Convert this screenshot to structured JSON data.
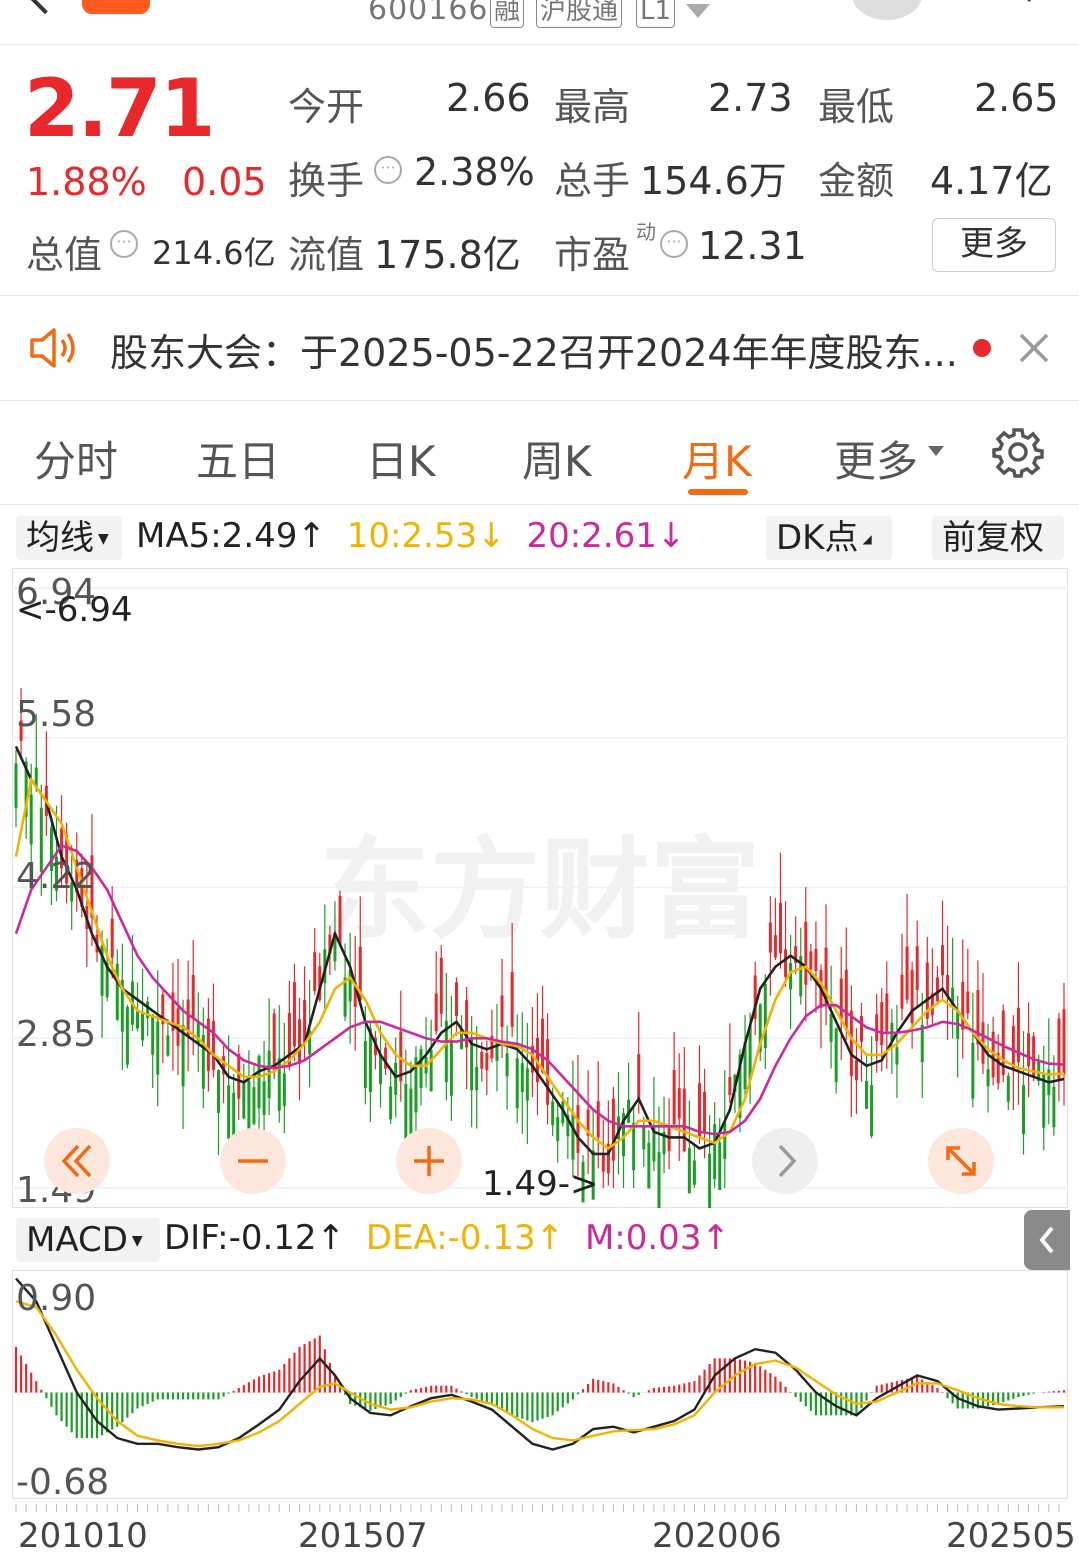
{
  "header": {
    "code": "600166",
    "tags": [
      "融",
      "沪股通",
      "L1"
    ]
  },
  "quote": {
    "price": "2.71",
    "change_pct": "1.88%",
    "change": "0.05",
    "open_label": "今开",
    "open": "2.66",
    "high_label": "最高",
    "high": "2.73",
    "low_label": "最低",
    "low": "2.65",
    "turnover_label": "换手",
    "turnover": "2.38%",
    "volume_label": "总手",
    "volume": "154.6万",
    "amount_label": "金额",
    "amount": "4.17亿",
    "mktcap_label": "总值",
    "mktcap": "214.6亿",
    "float_label": "流值",
    "float": "175.8亿",
    "pe_label": "市盈",
    "pe_sup": "动",
    "pe": "12.31",
    "more_label": "更多"
  },
  "notice": {
    "text": "股东大会：于2025-05-22召开2024年年度股东..."
  },
  "tabs": [
    "分时",
    "五日",
    "日K",
    "周K",
    "月K",
    "更多"
  ],
  "active_tab": "月K",
  "indicator_row": {
    "selector": "均线",
    "ma5": "MA5:2.49",
    "ma10": "10:2.53",
    "ma20": "20:2.61",
    "dk_label": "DK点",
    "adj_label": "前复权"
  },
  "kchart": {
    "y_ticks": [
      "6.94",
      "5.58",
      "4.22",
      "2.85",
      "1.49"
    ],
    "max_marker": "<-6.94",
    "min_marker": "1.49->",
    "watermark": "东方财富"
  },
  "macd_row": {
    "selector": "MACD",
    "dif": "DIF:-0.12",
    "dea": "DEA:-0.13",
    "m": "M:0.03",
    "y_ticks": [
      "0.90",
      "-0.68"
    ]
  },
  "x_dates": [
    "201010",
    "201507",
    "202006",
    "202505"
  ],
  "colors": {
    "up": "#e8282b",
    "down": "#1a9e24",
    "accent": "#f26a12",
    "ma5": "#222222",
    "ma10": "#f0b400",
    "ma20": "#cc2a9a"
  },
  "chart_data": {
    "type": "candlestick",
    "period": "monthly",
    "ylim": [
      1.49,
      6.94
    ],
    "ma_lines": [
      {
        "name": "MA5",
        "points": [
          [
            0,
            5.5
          ],
          [
            3,
            5.2
          ],
          [
            6,
            5.0
          ],
          [
            9,
            4.5
          ],
          [
            12,
            4.2
          ],
          [
            15,
            3.8
          ],
          [
            18,
            3.5
          ],
          [
            21,
            3.3
          ],
          [
            24,
            3.2
          ],
          [
            27,
            3.1
          ],
          [
            30,
            3.0
          ],
          [
            33,
            2.9
          ],
          [
            36,
            2.8
          ],
          [
            39,
            2.7
          ],
          [
            42,
            2.5
          ],
          [
            45,
            2.45
          ],
          [
            48,
            2.55
          ],
          [
            51,
            2.6
          ],
          [
            54,
            2.7
          ],
          [
            57,
            2.8
          ],
          [
            60,
            3.3
          ],
          [
            63,
            3.8
          ],
          [
            66,
            3.5
          ],
          [
            69,
            3.0
          ],
          [
            72,
            2.7
          ],
          [
            75,
            2.5
          ],
          [
            78,
            2.55
          ],
          [
            81,
            2.7
          ],
          [
            84,
            2.9
          ],
          [
            87,
            3.0
          ],
          [
            90,
            2.8
          ],
          [
            93,
            2.75
          ],
          [
            96,
            2.8
          ],
          [
            99,
            2.75
          ],
          [
            102,
            2.6
          ],
          [
            105,
            2.4
          ],
          [
            108,
            2.2
          ],
          [
            111,
            1.95
          ],
          [
            114,
            1.8
          ],
          [
            117,
            1.8
          ],
          [
            120,
            2.1
          ],
          [
            123,
            2.3
          ],
          [
            126,
            2.0
          ],
          [
            129,
            1.95
          ],
          [
            132,
            1.95
          ],
          [
            135,
            1.85
          ],
          [
            138,
            1.9
          ],
          [
            141,
            2.2
          ],
          [
            144,
            2.8
          ],
          [
            147,
            3.3
          ],
          [
            150,
            3.5
          ],
          [
            153,
            3.6
          ],
          [
            156,
            3.5
          ],
          [
            159,
            3.3
          ],
          [
            162,
            3.0
          ],
          [
            165,
            2.7
          ],
          [
            168,
            2.6
          ],
          [
            171,
            2.65
          ],
          [
            174,
            2.9
          ],
          [
            177,
            3.1
          ],
          [
            180,
            3.2
          ],
          [
            183,
            3.3
          ],
          [
            186,
            3.1
          ],
          [
            189,
            2.9
          ],
          [
            192,
            2.7
          ],
          [
            195,
            2.6
          ],
          [
            198,
            2.55
          ],
          [
            201,
            2.5
          ],
          [
            204,
            2.45
          ],
          [
            207,
            2.48
          ]
        ]
      },
      {
        "name": "MA10",
        "points": [
          [
            0,
            4.5
          ],
          [
            3,
            5.2
          ],
          [
            6,
            5.0
          ],
          [
            9,
            4.8
          ],
          [
            12,
            4.4
          ],
          [
            15,
            4.0
          ],
          [
            18,
            3.6
          ],
          [
            21,
            3.3
          ],
          [
            24,
            3.1
          ],
          [
            27,
            3.05
          ],
          [
            30,
            3.0
          ],
          [
            33,
            2.95
          ],
          [
            36,
            2.85
          ],
          [
            39,
            2.7
          ],
          [
            42,
            2.6
          ],
          [
            45,
            2.5
          ],
          [
            48,
            2.5
          ],
          [
            51,
            2.55
          ],
          [
            54,
            2.65
          ],
          [
            57,
            2.8
          ],
          [
            60,
            3.0
          ],
          [
            63,
            3.3
          ],
          [
            66,
            3.4
          ],
          [
            69,
            3.2
          ],
          [
            72,
            2.9
          ],
          [
            75,
            2.7
          ],
          [
            78,
            2.6
          ],
          [
            81,
            2.6
          ],
          [
            84,
            2.75
          ],
          [
            87,
            2.9
          ],
          [
            90,
            2.9
          ],
          [
            93,
            2.85
          ],
          [
            96,
            2.8
          ],
          [
            99,
            2.78
          ],
          [
            102,
            2.7
          ],
          [
            105,
            2.5
          ],
          [
            108,
            2.3
          ],
          [
            111,
            2.1
          ],
          [
            114,
            1.95
          ],
          [
            117,
            1.85
          ],
          [
            120,
            1.95
          ],
          [
            123,
            2.1
          ],
          [
            126,
            2.1
          ],
          [
            129,
            2.05
          ],
          [
            132,
            2.0
          ],
          [
            135,
            1.95
          ],
          [
            138,
            1.9
          ],
          [
            141,
            2.0
          ],
          [
            144,
            2.3
          ],
          [
            147,
            2.8
          ],
          [
            150,
            3.2
          ],
          [
            153,
            3.45
          ],
          [
            156,
            3.5
          ],
          [
            159,
            3.35
          ],
          [
            162,
            3.1
          ],
          [
            165,
            2.85
          ],
          [
            168,
            2.7
          ],
          [
            171,
            2.7
          ],
          [
            174,
            2.8
          ],
          [
            177,
            2.95
          ],
          [
            180,
            3.1
          ],
          [
            183,
            3.2
          ],
          [
            186,
            3.1
          ],
          [
            189,
            2.9
          ],
          [
            192,
            2.75
          ],
          [
            195,
            2.65
          ],
          [
            198,
            2.58
          ],
          [
            201,
            2.55
          ],
          [
            204,
            2.52
          ],
          [
            207,
            2.53
          ]
        ]
      },
      {
        "name": "MA20",
        "points": [
          [
            0,
            3.8
          ],
          [
            3,
            4.2
          ],
          [
            6,
            4.4
          ],
          [
            9,
            4.6
          ],
          [
            12,
            4.55
          ],
          [
            15,
            4.4
          ],
          [
            18,
            4.2
          ],
          [
            21,
            3.9
          ],
          [
            24,
            3.6
          ],
          [
            27,
            3.4
          ],
          [
            30,
            3.25
          ],
          [
            33,
            3.1
          ],
          [
            36,
            3.0
          ],
          [
            39,
            2.9
          ],
          [
            42,
            2.75
          ],
          [
            45,
            2.65
          ],
          [
            48,
            2.6
          ],
          [
            51,
            2.58
          ],
          [
            54,
            2.6
          ],
          [
            57,
            2.65
          ],
          [
            60,
            2.75
          ],
          [
            63,
            2.85
          ],
          [
            66,
            2.95
          ],
          [
            69,
            3.0
          ],
          [
            72,
            3.0
          ],
          [
            75,
            2.95
          ],
          [
            78,
            2.9
          ],
          [
            81,
            2.85
          ],
          [
            84,
            2.82
          ],
          [
            87,
            2.82
          ],
          [
            90,
            2.85
          ],
          [
            93,
            2.85
          ],
          [
            96,
            2.82
          ],
          [
            99,
            2.8
          ],
          [
            102,
            2.75
          ],
          [
            105,
            2.65
          ],
          [
            108,
            2.5
          ],
          [
            111,
            2.35
          ],
          [
            114,
            2.2
          ],
          [
            117,
            2.1
          ],
          [
            120,
            2.05
          ],
          [
            123,
            2.05
          ],
          [
            126,
            2.05
          ],
          [
            129,
            2.05
          ],
          [
            132,
            2.05
          ],
          [
            135,
            2.0
          ],
          [
            138,
            1.98
          ],
          [
            141,
            2.0
          ],
          [
            144,
            2.1
          ],
          [
            147,
            2.3
          ],
          [
            150,
            2.6
          ],
          [
            153,
            2.85
          ],
          [
            156,
            3.05
          ],
          [
            159,
            3.15
          ],
          [
            162,
            3.15
          ],
          [
            165,
            3.05
          ],
          [
            168,
            2.95
          ],
          [
            171,
            2.9
          ],
          [
            174,
            2.9
          ],
          [
            177,
            2.92
          ],
          [
            180,
            2.95
          ],
          [
            183,
            3.0
          ],
          [
            186,
            2.98
          ],
          [
            189,
            2.92
          ],
          [
            192,
            2.85
          ],
          [
            195,
            2.78
          ],
          [
            198,
            2.72
          ],
          [
            201,
            2.66
          ],
          [
            204,
            2.62
          ],
          [
            207,
            2.61
          ]
        ]
      }
    ],
    "macd": {
      "ylim": [
        -0.68,
        0.9
      ],
      "dif": [
        [
          0,
          1.0
        ],
        [
          4,
          0.8
        ],
        [
          8,
          0.4
        ],
        [
          12,
          0.0
        ],
        [
          16,
          -0.25
        ],
        [
          20,
          -0.4
        ],
        [
          24,
          -0.45
        ],
        [
          28,
          -0.45
        ],
        [
          32,
          -0.48
        ],
        [
          36,
          -0.5
        ],
        [
          40,
          -0.48
        ],
        [
          44,
          -0.4
        ],
        [
          48,
          -0.28
        ],
        [
          52,
          -0.15
        ],
        [
          56,
          0.1
        ],
        [
          60,
          0.3
        ],
        [
          63,
          0.15
        ],
        [
          66,
          -0.05
        ],
        [
          70,
          -0.18
        ],
        [
          74,
          -0.2
        ],
        [
          78,
          -0.12
        ],
        [
          82,
          -0.05
        ],
        [
          86,
          -0.02
        ],
        [
          90,
          -0.08
        ],
        [
          94,
          -0.15
        ],
        [
          98,
          -0.3
        ],
        [
          102,
          -0.45
        ],
        [
          106,
          -0.5
        ],
        [
          110,
          -0.45
        ],
        [
          114,
          -0.32
        ],
        [
          118,
          -0.3
        ],
        [
          122,
          -0.35
        ],
        [
          126,
          -0.3
        ],
        [
          130,
          -0.25
        ],
        [
          134,
          -0.15
        ],
        [
          138,
          0.15
        ],
        [
          142,
          0.3
        ],
        [
          146,
          0.38
        ],
        [
          150,
          0.35
        ],
        [
          154,
          0.2
        ],
        [
          158,
          0.0
        ],
        [
          162,
          -0.12
        ],
        [
          166,
          -0.2
        ],
        [
          170,
          -0.05
        ],
        [
          174,
          0.05
        ],
        [
          178,
          0.15
        ],
        [
          182,
          0.1
        ],
        [
          186,
          -0.05
        ],
        [
          190,
          -0.12
        ],
        [
          194,
          -0.15
        ],
        [
          198,
          -0.14
        ],
        [
          202,
          -0.13
        ],
        [
          207,
          -0.12
        ]
      ],
      "dea": [
        [
          0,
          0.8
        ],
        [
          4,
          0.75
        ],
        [
          8,
          0.5
        ],
        [
          12,
          0.2
        ],
        [
          16,
          -0.05
        ],
        [
          20,
          -0.25
        ],
        [
          24,
          -0.38
        ],
        [
          28,
          -0.42
        ],
        [
          32,
          -0.45
        ],
        [
          36,
          -0.47
        ],
        [
          40,
          -0.45
        ],
        [
          44,
          -0.42
        ],
        [
          48,
          -0.35
        ],
        [
          52,
          -0.25
        ],
        [
          56,
          -0.1
        ],
        [
          60,
          0.05
        ],
        [
          63,
          0.08
        ],
        [
          66,
          0.0
        ],
        [
          70,
          -0.1
        ],
        [
          74,
          -0.15
        ],
        [
          78,
          -0.13
        ],
        [
          82,
          -0.08
        ],
        [
          86,
          -0.05
        ],
        [
          90,
          -0.06
        ],
        [
          94,
          -0.1
        ],
        [
          98,
          -0.2
        ],
        [
          102,
          -0.32
        ],
        [
          106,
          -0.4
        ],
        [
          110,
          -0.42
        ],
        [
          114,
          -0.38
        ],
        [
          118,
          -0.34
        ],
        [
          122,
          -0.33
        ],
        [
          126,
          -0.32
        ],
        [
          130,
          -0.28
        ],
        [
          134,
          -0.2
        ],
        [
          138,
          0.0
        ],
        [
          142,
          0.15
        ],
        [
          146,
          0.25
        ],
        [
          150,
          0.28
        ],
        [
          154,
          0.22
        ],
        [
          158,
          0.1
        ],
        [
          162,
          -0.02
        ],
        [
          166,
          -0.1
        ],
        [
          170,
          -0.08
        ],
        [
          174,
          0.0
        ],
        [
          178,
          0.08
        ],
        [
          182,
          0.08
        ],
        [
          186,
          0.02
        ],
        [
          190,
          -0.05
        ],
        [
          194,
          -0.1
        ],
        [
          198,
          -0.12
        ],
        [
          202,
          -0.13
        ],
        [
          207,
          -0.13
        ]
      ]
    }
  }
}
